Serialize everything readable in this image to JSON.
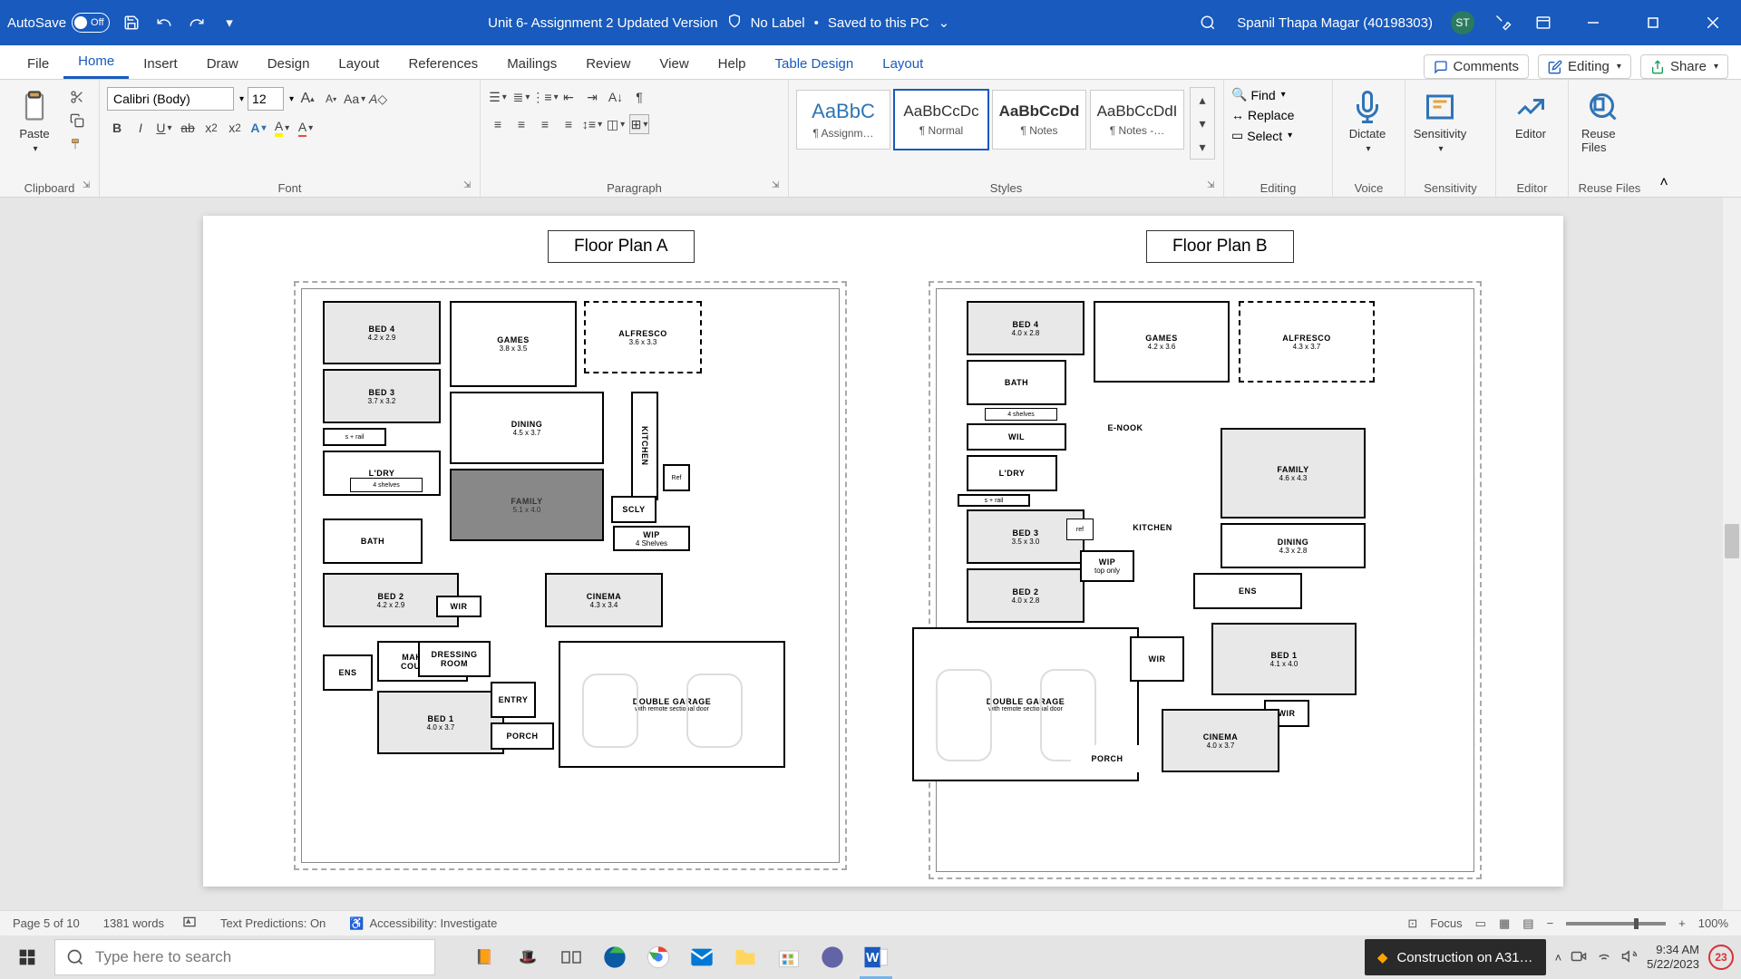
{
  "titlebar": {
    "autosave": "AutoSave",
    "autosave_state": "Off",
    "doc_title": "Unit 6- Assignment 2 Updated Version",
    "label_badge": "No Label",
    "save_state": "Saved to this PC",
    "user_name": "Spanil Thapa Magar (40198303)",
    "user_initials": "ST"
  },
  "tabs": {
    "file": "File",
    "home": "Home",
    "insert": "Insert",
    "draw": "Draw",
    "design": "Design",
    "layout": "Layout",
    "references": "References",
    "mailings": "Mailings",
    "review": "Review",
    "view": "View",
    "help": "Help",
    "table_design": "Table Design",
    "table_layout": "Layout",
    "comments": "Comments",
    "editing": "Editing",
    "share": "Share"
  },
  "ribbon": {
    "clipboard": {
      "label": "Clipboard",
      "paste": "Paste"
    },
    "font": {
      "label": "Font",
      "name": "Calibri (Body)",
      "size": "12"
    },
    "paragraph": {
      "label": "Paragraph"
    },
    "styles": {
      "label": "Styles",
      "items": [
        {
          "preview": "AaBbC",
          "name": "¶ Assignm…"
        },
        {
          "preview": "AaBbCcDc",
          "name": "¶ Normal"
        },
        {
          "preview": "AaBbCcDd",
          "name": "¶ Notes"
        },
        {
          "preview": "AaBbCcDdI",
          "name": "¶ Notes -…"
        }
      ]
    },
    "editing": {
      "label": "Editing",
      "find": "Find",
      "replace": "Replace",
      "select": "Select"
    },
    "voice": {
      "label": "Voice",
      "dictate": "Dictate"
    },
    "sensitivity": {
      "label": "Sensitivity",
      "btn": "Sensitivity"
    },
    "editor": {
      "label": "Editor",
      "btn": "Editor"
    },
    "reuse": {
      "label": "Reuse Files",
      "btn": "Reuse Files"
    }
  },
  "document": {
    "plan_a_label": "Floor Plan A",
    "plan_b_label": "Floor Plan B",
    "plan_a": {
      "bed4": {
        "n": "BED 4",
        "d": "4.2 x 2.9"
      },
      "bed3": {
        "n": "BED 3",
        "d": "3.7 x 3.2"
      },
      "ldry": {
        "n": "L'DRY",
        "d": ""
      },
      "bath": {
        "n": "BATH",
        "d": ""
      },
      "bed2": {
        "n": "BED 2",
        "d": "4.2 x 2.9"
      },
      "shelves": "4 shelves",
      "srail": "s + rail",
      "makeup": {
        "n": "MAKE-UP COUNTER",
        "d": ""
      },
      "ens": {
        "n": "ENS",
        "d": ""
      },
      "bed1": {
        "n": "BED 1",
        "d": "4.0 x 3.7"
      },
      "games": {
        "n": "GAMES",
        "d": "3.8 x 3.5"
      },
      "dining": {
        "n": "DINING",
        "d": "4.5 x 3.7"
      },
      "family": {
        "n": "FAMILY",
        "d": "5.1 x 4.0"
      },
      "wir": {
        "n": "WIR",
        "d": ""
      },
      "dressing": {
        "n": "DRESSING ROOM",
        "d": ""
      },
      "entry": {
        "n": "ENTRY",
        "d": ""
      },
      "porch": {
        "n": "PORCH",
        "d": ""
      },
      "alfresco": {
        "n": "ALFRESCO",
        "d": "3.6 x 3.3"
      },
      "kitchen": {
        "n": "KITCHEN",
        "d": ""
      },
      "scly": {
        "n": "SCLY",
        "d": ""
      },
      "wip": {
        "n": "WIP",
        "d": "4 Shelves"
      },
      "ref": "Ref",
      "cinema": {
        "n": "CINEMA",
        "d": "4.3 x 3.4"
      },
      "garage": {
        "n": "DOUBLE GARAGE",
        "d": "with remote sectional door"
      }
    },
    "plan_b": {
      "bed4": {
        "n": "BED 4",
        "d": "4.0 x 2.8"
      },
      "bath": {
        "n": "BATH",
        "d": ""
      },
      "shelves": "4 shelves",
      "wil": {
        "n": "WIL",
        "d": ""
      },
      "ldry": {
        "n": "L'DRY",
        "d": ""
      },
      "bed3": {
        "n": "BED 3",
        "d": "3.5 x 3.0"
      },
      "srail": "s + rail",
      "bed2": {
        "n": "BED 2",
        "d": "4.0 x 2.8"
      },
      "garage": {
        "n": "DOUBLE GARAGE",
        "d": "with remote sectional door"
      },
      "games": {
        "n": "GAMES",
        "d": "4.2 x 3.6"
      },
      "enook": {
        "n": "E-NOOK",
        "d": ""
      },
      "kitchen": {
        "n": "KITCHEN",
        "d": ""
      },
      "ref": "ref",
      "wip": {
        "n": "WIP",
        "d": "top only"
      },
      "wir": {
        "n": "WIR",
        "d": ""
      },
      "wir2": {
        "n": "WIR",
        "d": ""
      },
      "porch": {
        "n": "PORCH",
        "d": ""
      },
      "alfresco": {
        "n": "ALFRESCO",
        "d": "4.3 x 3.7"
      },
      "family": {
        "n": "FAMILY",
        "d": "4.6 x 4.3"
      },
      "dining": {
        "n": "DINING",
        "d": "4.3 x 2.8"
      },
      "ens": {
        "n": "ENS",
        "d": ""
      },
      "bed1": {
        "n": "BED 1",
        "d": "4.1 x 4.0"
      },
      "cinema": {
        "n": "CINEMA",
        "d": "4.0 x 3.7"
      }
    }
  },
  "statusbar": {
    "page": "Page 5 of 10",
    "words": "1381 words",
    "predictions": "Text Predictions: On",
    "accessibility": "Accessibility: Investigate",
    "focus": "Focus",
    "zoom": "100%"
  },
  "taskbar": {
    "search_placeholder": "Type here to search",
    "news": "Construction on A31…",
    "time": "9:34 AM",
    "date": "5/22/2023",
    "notif_count": "23"
  }
}
